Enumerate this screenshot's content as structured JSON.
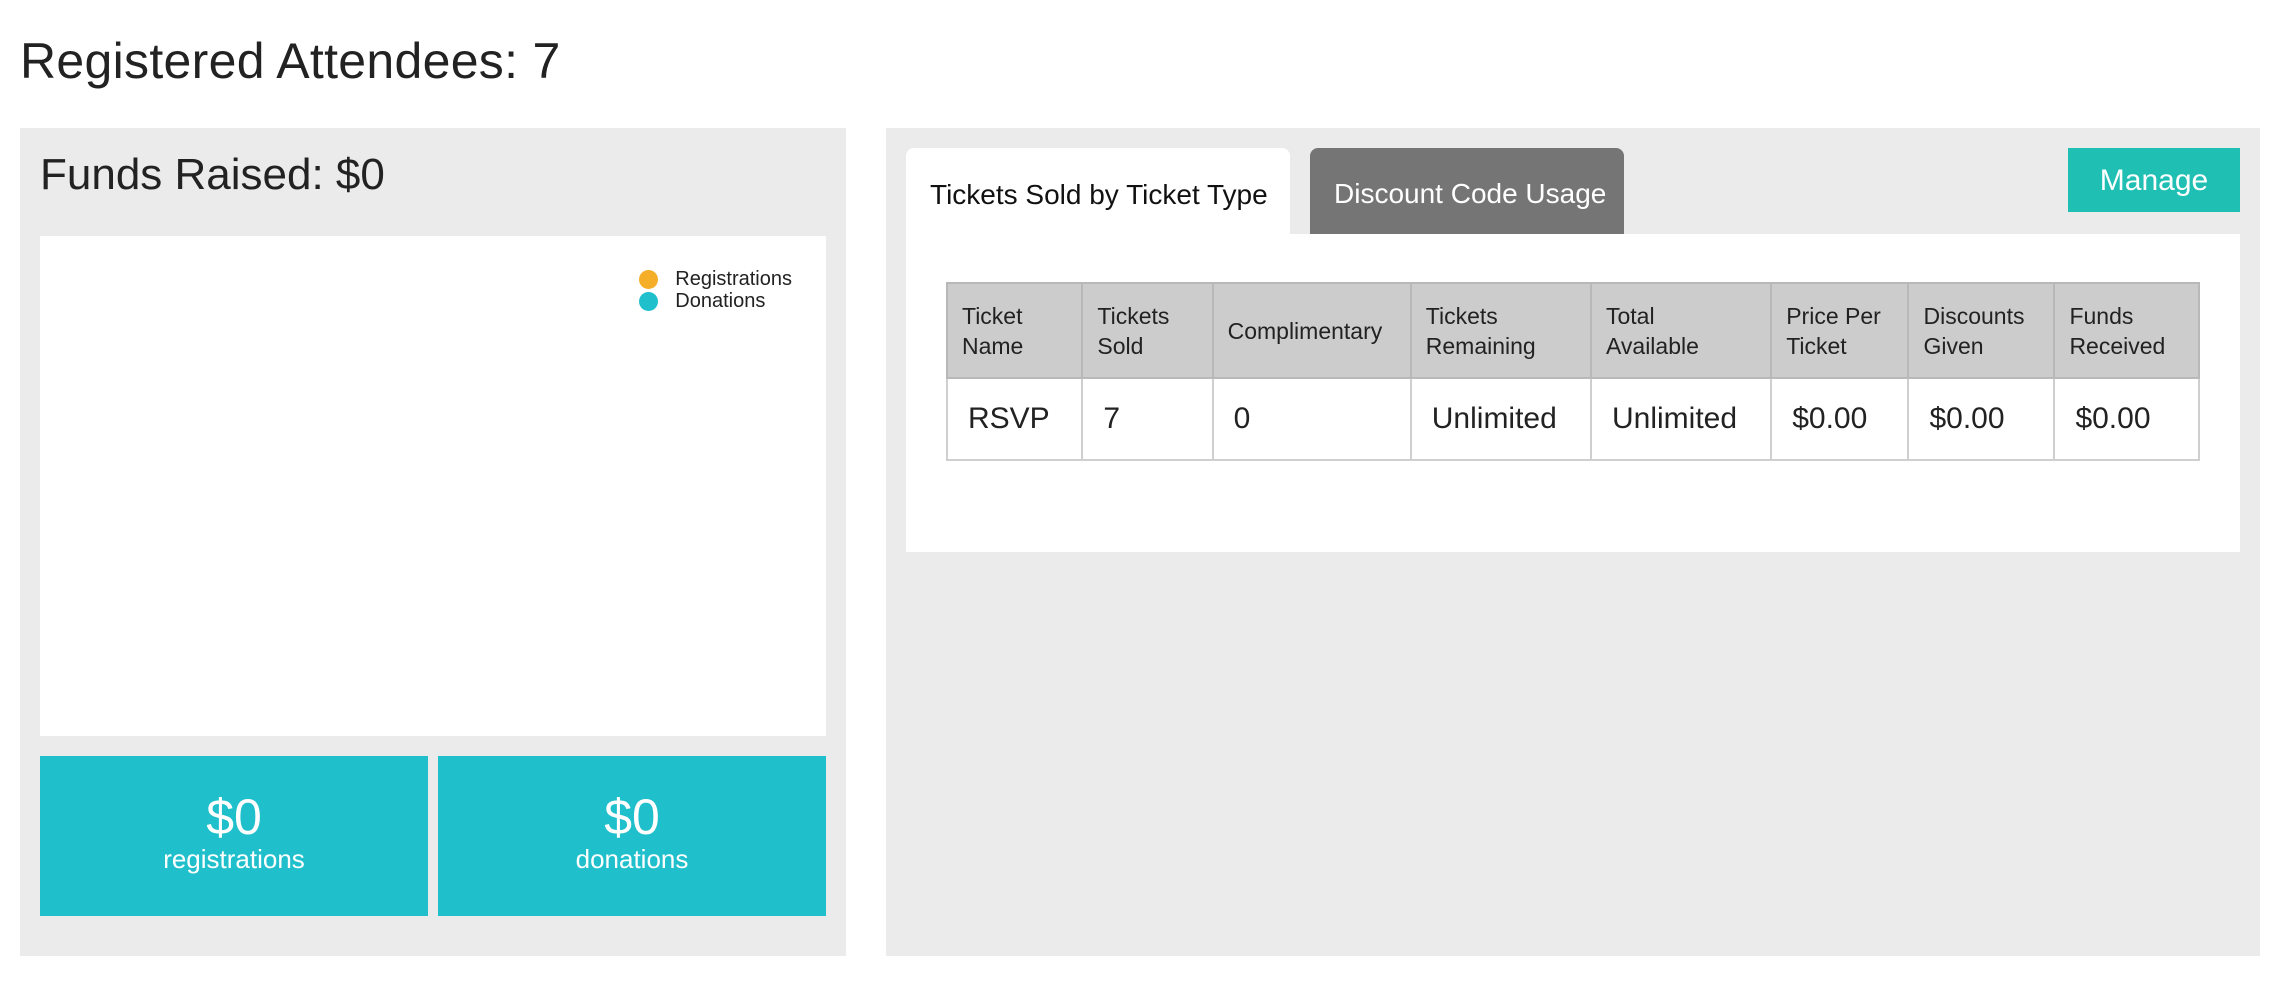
{
  "page": {
    "title": "Registered Attendees: 7"
  },
  "funds": {
    "title": "Funds Raised: $0",
    "legend": [
      {
        "label": "Registrations",
        "color": "#f5ae27"
      },
      {
        "label": "Donations",
        "color": "#1fbfcc"
      }
    ],
    "stats": [
      {
        "value": "$0",
        "label": "registrations"
      },
      {
        "value": "$0",
        "label": "donations"
      }
    ]
  },
  "tickets": {
    "tabs": [
      {
        "label": "Tickets Sold by Ticket Type",
        "active": true
      },
      {
        "label": "Discount Code Usage",
        "active": false
      }
    ],
    "manage_label": "Manage",
    "columns": [
      [
        "Ticket",
        "Name"
      ],
      [
        "Tickets",
        "Sold"
      ],
      [
        "Complimentary"
      ],
      [
        "Tickets",
        "Remaining"
      ],
      [
        "Total",
        "Available"
      ],
      [
        "Price Per",
        "Ticket"
      ],
      [
        "Discounts",
        "Given"
      ],
      [
        "Funds",
        "Received"
      ]
    ],
    "rows": [
      [
        "RSVP",
        "7",
        "0",
        "Unlimited",
        "Unlimited",
        "$0.00",
        "$0.00",
        "$0.00"
      ]
    ]
  },
  "colors": {
    "accent_teal": "#1fbfcc",
    "manage_teal": "#1fbfb3",
    "registrations_orange": "#f5ae27",
    "inactive_tab": "#757575",
    "panel_bg": "#ebebeb"
  }
}
